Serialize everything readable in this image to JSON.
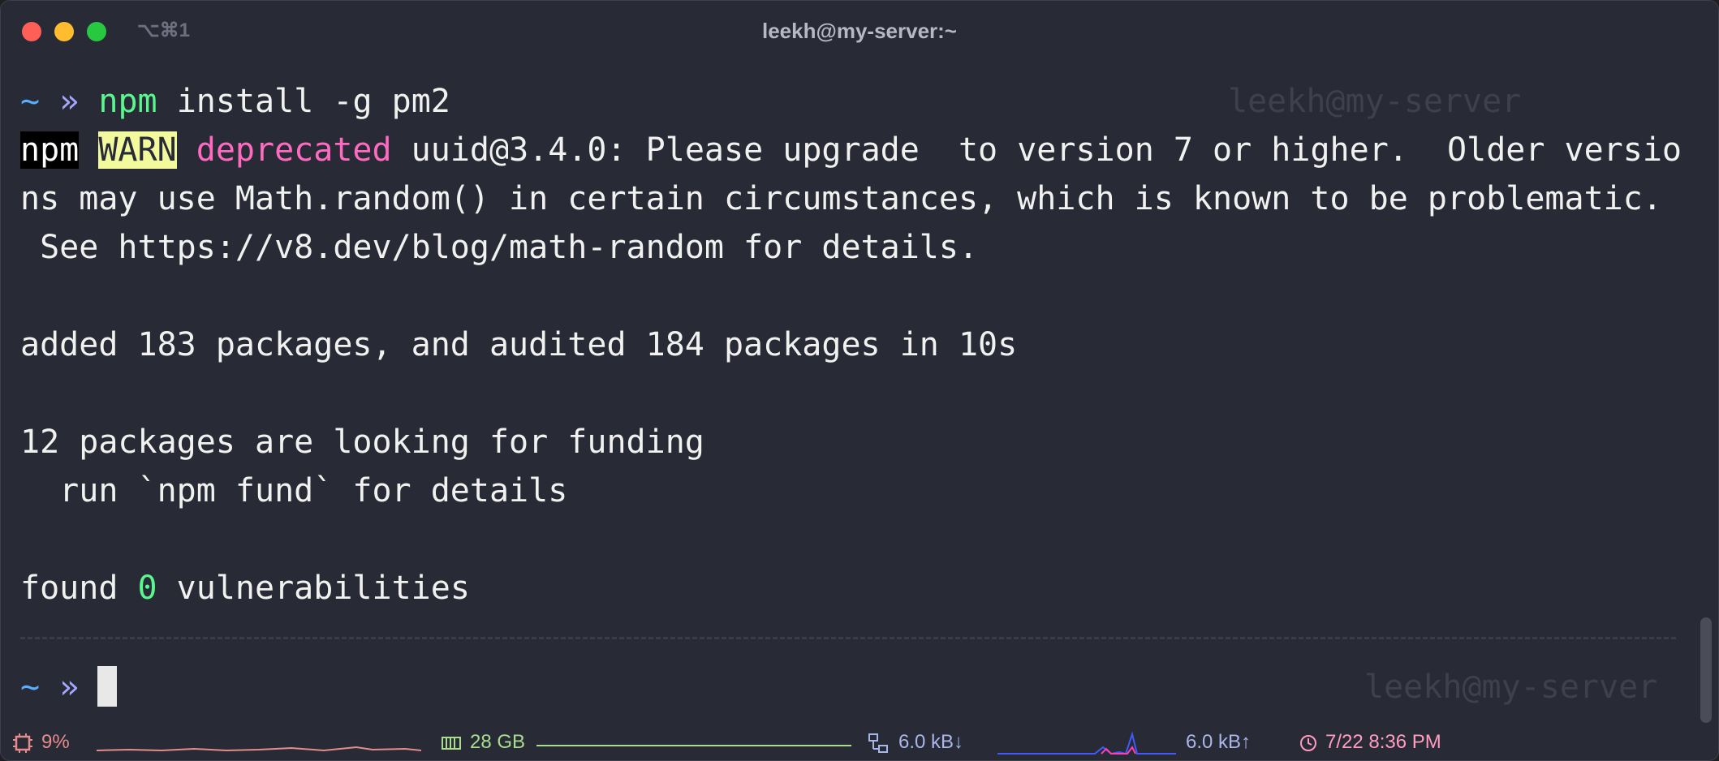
{
  "window": {
    "shortcut": "⌥⌘1",
    "title": "leekh@my-server:~"
  },
  "terminal": {
    "prompt_tilde": "~",
    "prompt_arrow": "»",
    "cmd_npm": "npm",
    "cmd_rest": " install -g pm2",
    "ghost_host": "leekh@my-server",
    "warn_npm": "npm",
    "warn_label": "WARN",
    "warn_deprecated": "deprecated",
    "warn_text": " uuid@3.4.0: Please upgrade  to version 7 or higher.  Older versio",
    "line3": "ns may use Math.random() in certain circumstances, which is known to be problematic.",
    "line4": " See https://v8.dev/blog/math-random for details.",
    "line6": "added 183 packages, and audited 184 packages in 10s",
    "line8": "12 packages are looking for funding",
    "line9": "  run `npm fund` for details",
    "found_prefix": "found ",
    "found_count": "0",
    "found_suffix": " vulnerabilities"
  },
  "statusbar": {
    "cpu_icon": "cpu-icon",
    "cpu": "9%",
    "mem_icon": "memory-icon",
    "mem": "28 GB",
    "net_icon": "network-icon",
    "net_down": "6.0 kB↓",
    "net_up": "6.0 kB↑",
    "clock_icon": "clock-icon",
    "datetime": "7/22 8:36 PM"
  },
  "colors": {
    "background": "#282a36",
    "green": "#5af78e",
    "pink": "#ff6ac1",
    "warn_bg": "#f3f99d",
    "status_cpu": "#e58c8c",
    "status_mem": "#a8dc8f",
    "status_net": "#a9b6e8",
    "status_clock": "#ff9cc1"
  }
}
